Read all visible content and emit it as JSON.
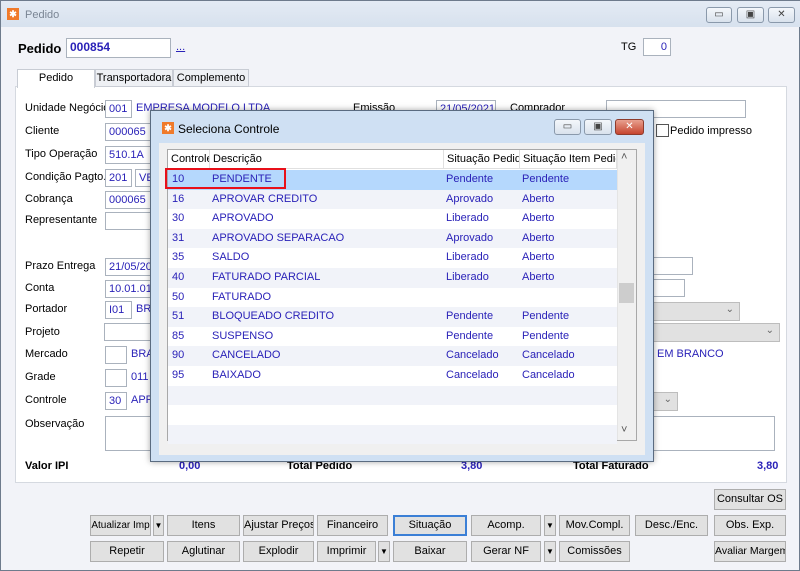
{
  "window": {
    "title": "Pedido",
    "icon": "app-logo-icon",
    "minimize": "▭",
    "maximize": "▣",
    "close": "✕"
  },
  "header": {
    "pedido_label": "Pedido",
    "pedido_value": "000854",
    "lookup": "...",
    "tg_label": "TG",
    "tg_value": "0"
  },
  "tabs": [
    {
      "label": "Pedido",
      "active": true
    },
    {
      "label": "Transportadora"
    },
    {
      "label": "Complemento"
    }
  ],
  "form": {
    "unidade_label": "Unidade Negócio",
    "unidade_code": "001",
    "unidade_name": "EMPRESA MODELO LTDA",
    "emissao_label": "Emissão",
    "emissao_value": "21/05/2021",
    "comprador_label": "Comprador",
    "comprador_value": "",
    "cliente_label": "Cliente",
    "cliente_value": "000065",
    "pedido_impresso_label": "Pedido impresso",
    "pedido_impresso_checked": false,
    "tipo_label": "Tipo Operação",
    "tipo_value": "510.1A",
    "condicao_label": "Condição Pagto.",
    "condicao_code": "201",
    "condicao_name": "VEN",
    "cobranca_label": "Cobrança",
    "cobranca_value": "000065",
    "representante_label": "Representante",
    "representante_value": "",
    "prazo_label": "Prazo Entrega",
    "prazo_value": "21/05/20",
    "conta_label": "Conta",
    "conta_value": "10.01.01",
    "portador_label": "Portador",
    "portador_code": "I01",
    "portador_name": "BRA",
    "projeto_label": "Projeto",
    "projeto_value": "",
    "mercado_label": "Mercado",
    "mercado_name": "BRA",
    "mercado_right": "EM BRANCO",
    "grade_label": "Grade",
    "grade_name": "011",
    "controle_label": "Controle",
    "controle_code": "30",
    "controle_name": "APR",
    "observacao_label": "Observação"
  },
  "totals": {
    "ipi_label": "Valor IPI",
    "ipi_value": "0,00",
    "pedido_label": "Total Pedido",
    "pedido_value": "3,80",
    "faturado_label": "Total Faturado",
    "faturado_value": "3,80"
  },
  "buttons": {
    "consultar_os": "Consultar OS",
    "row1": [
      "Atualizar Imp",
      "Itens",
      "Ajustar Preços",
      "Financeiro",
      "Situação",
      "Acomp.",
      "Mov.Compl.",
      "Desc./Enc.",
      "Obs. Exp."
    ],
    "row2": [
      "Repetir",
      "Aglutinar",
      "Explodir",
      "Imprimir",
      "Baixar",
      "Gerar NF",
      "Comissões",
      "Avaliar Margem"
    ],
    "dropdown_arrow": "▼"
  },
  "dialog": {
    "title": "Seleciona Controle",
    "columns": [
      "Controle",
      "Descrição",
      "Situação Pedido",
      "Situação Item Pedido"
    ],
    "rows": [
      [
        "10",
        "PENDENTE",
        "Pendente",
        "Pendente"
      ],
      [
        "16",
        "APROVAR CREDITO",
        "Aprovado",
        "Aberto"
      ],
      [
        "30",
        "APROVADO",
        "Liberado",
        "Aberto"
      ],
      [
        "31",
        "APROVADO SEPARACAO",
        "Aprovado",
        "Aberto"
      ],
      [
        "35",
        "SALDO",
        "Liberado",
        "Aberto"
      ],
      [
        "40",
        "FATURADO PARCIAL",
        "Liberado",
        "Aberto"
      ],
      [
        "50",
        "FATURADO",
        "",
        ""
      ],
      [
        "51",
        "BLOQUEADO CREDITO",
        "Pendente",
        "Pendente"
      ],
      [
        "85",
        "SUSPENSO",
        "Pendente",
        "Pendente"
      ],
      [
        "90",
        "CANCELADO",
        "Cancelado",
        "Cancelado"
      ],
      [
        "95",
        "BAIXADO",
        "Cancelado",
        "Cancelado"
      ]
    ],
    "selected_row": 0,
    "highlight_color": "#e8101a",
    "scroll_up": "˄",
    "scroll_down": "˅"
  }
}
